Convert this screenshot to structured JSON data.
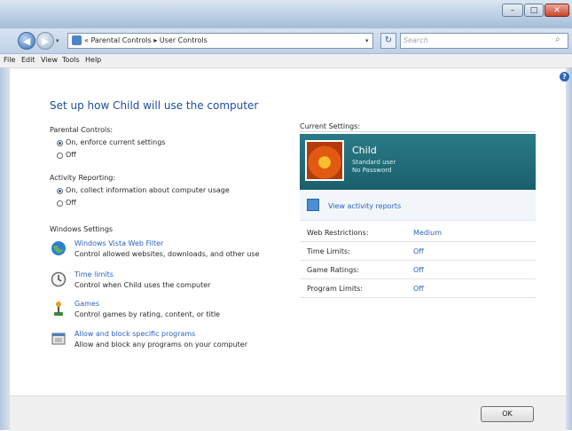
{
  "window": {
    "minimize": "–",
    "maximize": "□",
    "close": "✕"
  },
  "nav": {
    "back": "◀",
    "forward": "▶",
    "dropdown": "▾",
    "address_prefix": "▸",
    "breadcrumb": "« Parental Controls ▸ User Controls",
    "address_dropdown": "▾",
    "refresh": "↻",
    "search_placeholder": "Search",
    "search_icon": "search-icon"
  },
  "menu": [
    "File",
    "Edit",
    "View",
    "Tools",
    "Help"
  ],
  "help_icon": "?",
  "heading": "Set up how Child will use the computer",
  "parental_controls": {
    "label": "Parental Controls:",
    "options": [
      "On, enforce current settings",
      "Off"
    ],
    "selected": 0
  },
  "activity_reporting": {
    "label": "Activity Reporting:",
    "options": [
      "On, collect information about computer usage",
      "Off"
    ],
    "selected": 0
  },
  "windows_settings": {
    "label": "Windows Settings",
    "items": [
      {
        "icon": "globe-icon",
        "link": "Windows Vista Web Filter",
        "desc": "Control allowed websites, downloads, and other use"
      },
      {
        "icon": "clock-icon",
        "link": "Time limits",
        "desc": "Control when Child uses the computer"
      },
      {
        "icon": "joystick-icon",
        "link": "Games",
        "desc": "Control games by rating, content, or title"
      },
      {
        "icon": "programs-icon",
        "link": "Allow and block specific programs",
        "desc": "Allow and block any programs on your computer"
      }
    ]
  },
  "current_settings": {
    "label": "Current Settings:",
    "user": {
      "name": "Child",
      "role": "Standard user",
      "password": "No Password"
    },
    "activity_link": "View activity reports",
    "rows": [
      {
        "key": "Web Restrictions:",
        "value": "Medium"
      },
      {
        "key": "Time Limits:",
        "value": "Off"
      },
      {
        "key": "Game Ratings:",
        "value": "Off"
      },
      {
        "key": "Program Limits:",
        "value": "Off"
      }
    ]
  },
  "ok_button": "OK",
  "colors": {
    "link": "#2c62c2",
    "heading": "#1e4ea0",
    "banner": "#1b5f6c"
  }
}
